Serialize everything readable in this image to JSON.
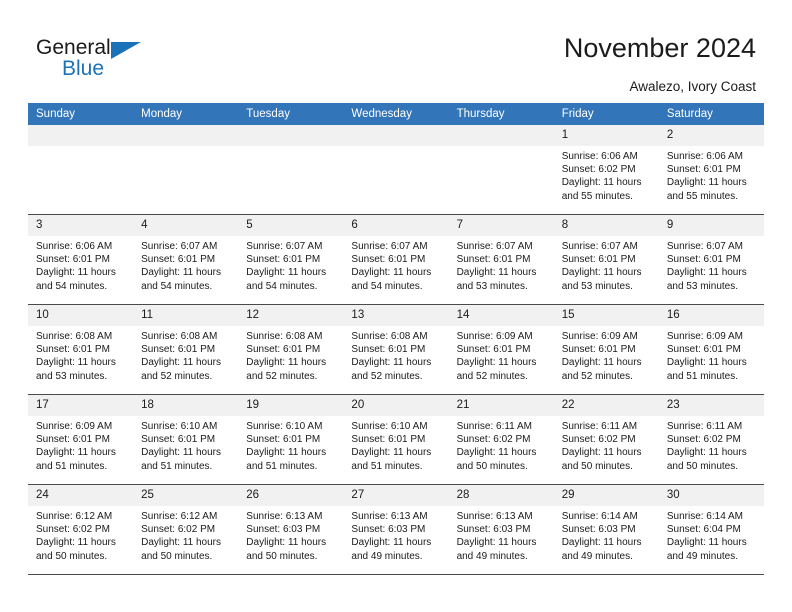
{
  "brand": {
    "name_part1": "General",
    "name_part2": "Blue",
    "accent_color": "#1b72b8"
  },
  "header": {
    "title": "November 2024",
    "subtitle": "Awalezo, Ivory Coast"
  },
  "theme": {
    "header_row_bg": "#3275b9",
    "daynum_bg": "#f1f1f1",
    "grid_line": "#4a4a4a",
    "text": "#1b1b1b"
  },
  "weekday_headers": [
    "Sunday",
    "Monday",
    "Tuesday",
    "Wednesday",
    "Thursday",
    "Friday",
    "Saturday"
  ],
  "weeks": [
    [
      {
        "day": "",
        "empty": true
      },
      {
        "day": "",
        "empty": true
      },
      {
        "day": "",
        "empty": true
      },
      {
        "day": "",
        "empty": true
      },
      {
        "day": "",
        "empty": true
      },
      {
        "day": "1",
        "sunrise": "Sunrise: 6:06 AM",
        "sunset": "Sunset: 6:02 PM",
        "daylight": "Daylight: 11 hours and 55 minutes."
      },
      {
        "day": "2",
        "sunrise": "Sunrise: 6:06 AM",
        "sunset": "Sunset: 6:01 PM",
        "daylight": "Daylight: 11 hours and 55 minutes."
      }
    ],
    [
      {
        "day": "3",
        "sunrise": "Sunrise: 6:06 AM",
        "sunset": "Sunset: 6:01 PM",
        "daylight": "Daylight: 11 hours and 54 minutes."
      },
      {
        "day": "4",
        "sunrise": "Sunrise: 6:07 AM",
        "sunset": "Sunset: 6:01 PM",
        "daylight": "Daylight: 11 hours and 54 minutes."
      },
      {
        "day": "5",
        "sunrise": "Sunrise: 6:07 AM",
        "sunset": "Sunset: 6:01 PM",
        "daylight": "Daylight: 11 hours and 54 minutes."
      },
      {
        "day": "6",
        "sunrise": "Sunrise: 6:07 AM",
        "sunset": "Sunset: 6:01 PM",
        "daylight": "Daylight: 11 hours and 54 minutes."
      },
      {
        "day": "7",
        "sunrise": "Sunrise: 6:07 AM",
        "sunset": "Sunset: 6:01 PM",
        "daylight": "Daylight: 11 hours and 53 minutes."
      },
      {
        "day": "8",
        "sunrise": "Sunrise: 6:07 AM",
        "sunset": "Sunset: 6:01 PM",
        "daylight": "Daylight: 11 hours and 53 minutes."
      },
      {
        "day": "9",
        "sunrise": "Sunrise: 6:07 AM",
        "sunset": "Sunset: 6:01 PM",
        "daylight": "Daylight: 11 hours and 53 minutes."
      }
    ],
    [
      {
        "day": "10",
        "sunrise": "Sunrise: 6:08 AM",
        "sunset": "Sunset: 6:01 PM",
        "daylight": "Daylight: 11 hours and 53 minutes."
      },
      {
        "day": "11",
        "sunrise": "Sunrise: 6:08 AM",
        "sunset": "Sunset: 6:01 PM",
        "daylight": "Daylight: 11 hours and 52 minutes."
      },
      {
        "day": "12",
        "sunrise": "Sunrise: 6:08 AM",
        "sunset": "Sunset: 6:01 PM",
        "daylight": "Daylight: 11 hours and 52 minutes."
      },
      {
        "day": "13",
        "sunrise": "Sunrise: 6:08 AM",
        "sunset": "Sunset: 6:01 PM",
        "daylight": "Daylight: 11 hours and 52 minutes."
      },
      {
        "day": "14",
        "sunrise": "Sunrise: 6:09 AM",
        "sunset": "Sunset: 6:01 PM",
        "daylight": "Daylight: 11 hours and 52 minutes."
      },
      {
        "day": "15",
        "sunrise": "Sunrise: 6:09 AM",
        "sunset": "Sunset: 6:01 PM",
        "daylight": "Daylight: 11 hours and 52 minutes."
      },
      {
        "day": "16",
        "sunrise": "Sunrise: 6:09 AM",
        "sunset": "Sunset: 6:01 PM",
        "daylight": "Daylight: 11 hours and 51 minutes."
      }
    ],
    [
      {
        "day": "17",
        "sunrise": "Sunrise: 6:09 AM",
        "sunset": "Sunset: 6:01 PM",
        "daylight": "Daylight: 11 hours and 51 minutes."
      },
      {
        "day": "18",
        "sunrise": "Sunrise: 6:10 AM",
        "sunset": "Sunset: 6:01 PM",
        "daylight": "Daylight: 11 hours and 51 minutes."
      },
      {
        "day": "19",
        "sunrise": "Sunrise: 6:10 AM",
        "sunset": "Sunset: 6:01 PM",
        "daylight": "Daylight: 11 hours and 51 minutes."
      },
      {
        "day": "20",
        "sunrise": "Sunrise: 6:10 AM",
        "sunset": "Sunset: 6:01 PM",
        "daylight": "Daylight: 11 hours and 51 minutes."
      },
      {
        "day": "21",
        "sunrise": "Sunrise: 6:11 AM",
        "sunset": "Sunset: 6:02 PM",
        "daylight": "Daylight: 11 hours and 50 minutes."
      },
      {
        "day": "22",
        "sunrise": "Sunrise: 6:11 AM",
        "sunset": "Sunset: 6:02 PM",
        "daylight": "Daylight: 11 hours and 50 minutes."
      },
      {
        "day": "23",
        "sunrise": "Sunrise: 6:11 AM",
        "sunset": "Sunset: 6:02 PM",
        "daylight": "Daylight: 11 hours and 50 minutes."
      }
    ],
    [
      {
        "day": "24",
        "sunrise": "Sunrise: 6:12 AM",
        "sunset": "Sunset: 6:02 PM",
        "daylight": "Daylight: 11 hours and 50 minutes."
      },
      {
        "day": "25",
        "sunrise": "Sunrise: 6:12 AM",
        "sunset": "Sunset: 6:02 PM",
        "daylight": "Daylight: 11 hours and 50 minutes."
      },
      {
        "day": "26",
        "sunrise": "Sunrise: 6:13 AM",
        "sunset": "Sunset: 6:03 PM",
        "daylight": "Daylight: 11 hours and 50 minutes."
      },
      {
        "day": "27",
        "sunrise": "Sunrise: 6:13 AM",
        "sunset": "Sunset: 6:03 PM",
        "daylight": "Daylight: 11 hours and 49 minutes."
      },
      {
        "day": "28",
        "sunrise": "Sunrise: 6:13 AM",
        "sunset": "Sunset: 6:03 PM",
        "daylight": "Daylight: 11 hours and 49 minutes."
      },
      {
        "day": "29",
        "sunrise": "Sunrise: 6:14 AM",
        "sunset": "Sunset: 6:03 PM",
        "daylight": "Daylight: 11 hours and 49 minutes."
      },
      {
        "day": "30",
        "sunrise": "Sunrise: 6:14 AM",
        "sunset": "Sunset: 6:04 PM",
        "daylight": "Daylight: 11 hours and 49 minutes."
      }
    ]
  ]
}
